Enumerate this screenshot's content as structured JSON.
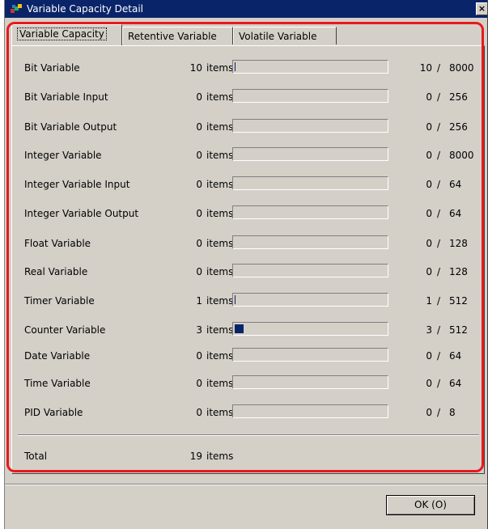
{
  "window": {
    "title": "Variable Capacity Detail",
    "close_glyph": "×"
  },
  "tabs": [
    {
      "label": "Variable Capacity",
      "active": true
    },
    {
      "label": "Retentive Variable",
      "active": false
    },
    {
      "label": "Volatile Variable",
      "active": false
    }
  ],
  "unit_label": "items",
  "rows": [
    {
      "label": "Bit Variable",
      "count": "10",
      "used": "10",
      "max": "8000",
      "fill_fraction": 0.00125
    },
    {
      "label": "Bit Variable Input",
      "count": "0",
      "used": "0",
      "max": "256",
      "fill_fraction": 0
    },
    {
      "label": "Bit Variable Output",
      "count": "0",
      "used": "0",
      "max": "256",
      "fill_fraction": 0
    },
    {
      "label": "Integer Variable",
      "count": "0",
      "used": "0",
      "max": "8000",
      "fill_fraction": 0
    },
    {
      "label": "Integer Variable Input",
      "count": "0",
      "used": "0",
      "max": "64",
      "fill_fraction": 0
    },
    {
      "label": "Integer Variable Output",
      "count": "0",
      "used": "0",
      "max": "64",
      "fill_fraction": 0
    },
    {
      "label": "Float Variable",
      "count": "0",
      "used": "0",
      "max": "128",
      "fill_fraction": 0
    },
    {
      "label": "Real Variable",
      "count": "0",
      "used": "0",
      "max": "128",
      "fill_fraction": 0
    },
    {
      "label": "Timer Variable",
      "count": "1",
      "used": "1",
      "max": "512",
      "fill_fraction": 0.002
    },
    {
      "label": "Counter Variable",
      "count": "3",
      "used": "3",
      "max": "512",
      "fill_fraction": 0.06
    },
    {
      "label": "Date Variable",
      "count": "0",
      "used": "0",
      "max": "64",
      "fill_fraction": 0
    },
    {
      "label": "Time Variable",
      "count": "0",
      "used": "0",
      "max": "64",
      "fill_fraction": 0
    },
    {
      "label": "PID Variable",
      "count": "0",
      "used": "0",
      "max": "8",
      "fill_fraction": 0
    }
  ],
  "slash": "/",
  "total": {
    "label": "Total",
    "count": "19",
    "unit": "items"
  },
  "ok_button": {
    "label": "OK (O)"
  },
  "colors": {
    "highlight": "#e8191f",
    "bar_fill": "#0a246a",
    "titlebar": "#0a246a"
  }
}
